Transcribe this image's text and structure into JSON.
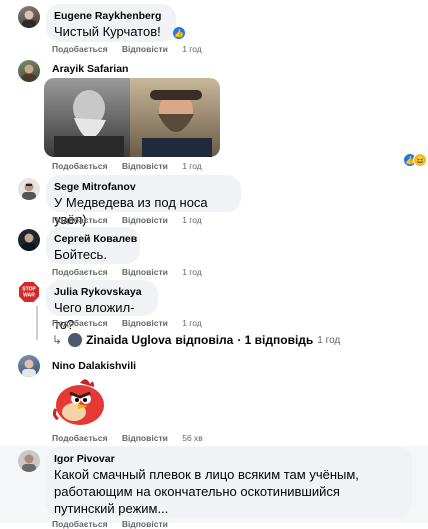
{
  "actions": {
    "like": "Подобається",
    "reply": "Відповісти"
  },
  "comments": [
    {
      "author": "Eugene Raykhenberg",
      "text": "Чистый Курчатов!",
      "time": "1 год"
    },
    {
      "author": "Arayik Safarian",
      "text": "",
      "time": "1 год"
    },
    {
      "author": "Sege Mitrofanov",
      "text": "У Медведева из под носа увёл)",
      "time": "1 год"
    },
    {
      "author": "Сергей Ковалев",
      "text": "Бойтесь.",
      "time": "1 год"
    },
    {
      "author": "Julia Rykovskaya",
      "text": "Чего вложил-то?",
      "time": "1 год",
      "avatar_label": "STOP WAR"
    },
    {
      "author": "Nino Dalakishvili",
      "text": "",
      "time": "56 хв"
    },
    {
      "author": "Igor Pivovar",
      "text": "Какой смачный плевок в лицо всяким там учёным, работающим на окончательно оскотинившийся путинский режим..."
    }
  ],
  "reply_summary": {
    "name": "Zinaida Uglova",
    "verb": "відповіла",
    "count": "· 1 відповідь",
    "time": "1 год"
  },
  "colors": {
    "like_blue": "#1877f2",
    "haha_yellow": "#f7b928",
    "love_red": "#f33e58",
    "bubble_bg": "#f0f2f5",
    "meta_gray": "#65676b"
  }
}
